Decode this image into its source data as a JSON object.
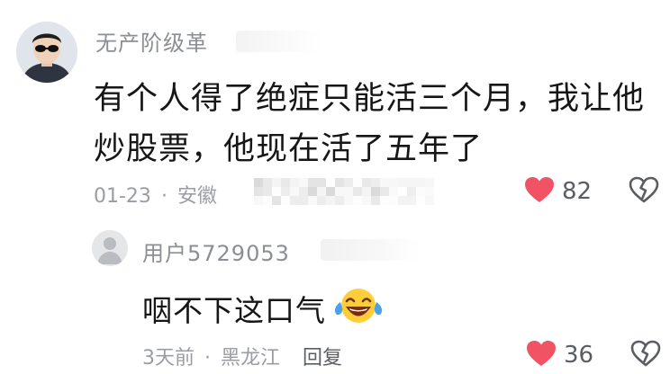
{
  "comment": {
    "username": "无产阶级革",
    "text": "有个人得了绝症只能活三个月，我让他炒股票，他现在活了五年了",
    "date": "01-23",
    "separator": "·",
    "location": "安徽",
    "like_count": "82",
    "colors": {
      "like": "#f25364",
      "meta": "#9a9da2"
    },
    "icons": {
      "like": "heart-icon",
      "dislike": "broken-heart-icon"
    }
  },
  "reply": {
    "username": "用户5729053",
    "text": "咽不下这口气",
    "emoji": "tears-of-joy-emoji",
    "date": "3天前",
    "separator": "·",
    "location": "黑龙江",
    "reply_label": "回复",
    "like_count": "36"
  }
}
